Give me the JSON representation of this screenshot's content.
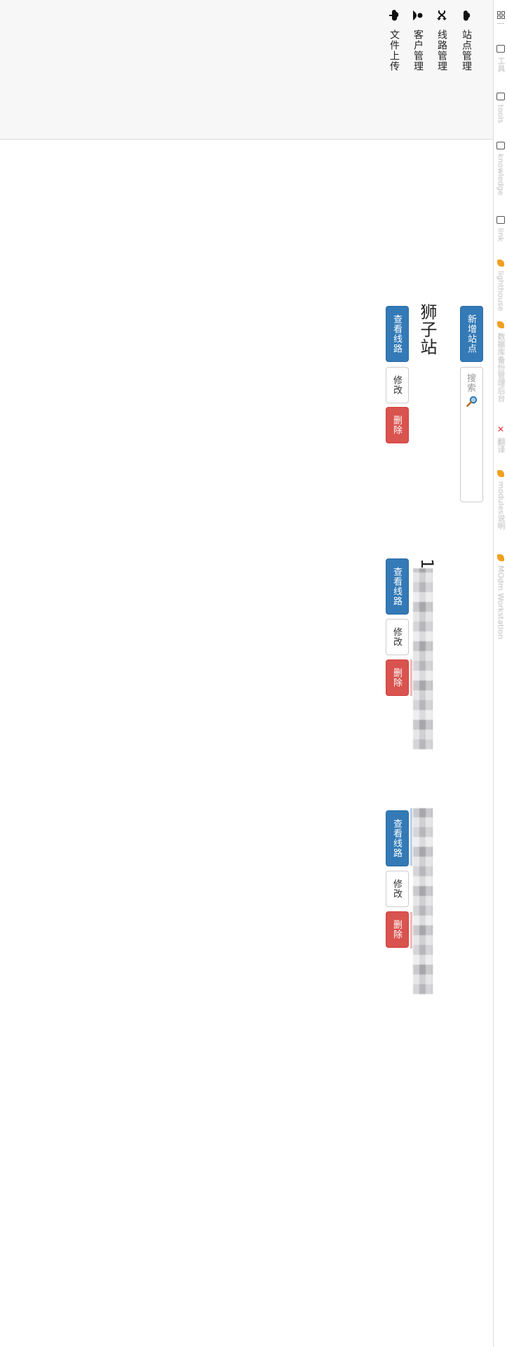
{
  "bookmarks": {
    "items": [
      {
        "icon": "folder-icon",
        "label": "工具"
      },
      {
        "icon": "folder-icon",
        "label": "tools"
      },
      {
        "icon": "folder-icon",
        "label": "knowledge"
      },
      {
        "icon": "folder-icon",
        "label": "link"
      },
      {
        "icon": "bookmark-icon",
        "label": "lighthouse"
      },
      {
        "icon": "bookmark-icon",
        "label": "数据库备份管理后台"
      },
      {
        "icon": "bookmark-icon",
        "label": "翻译"
      },
      {
        "icon": "bookmark-icon",
        "label": "modules说明"
      },
      {
        "icon": "bookmark-icon",
        "label": "MOdm Workstation"
      }
    ]
  },
  "sidebar": {
    "items": [
      {
        "icon": "cloud-icon",
        "label": "站点管理"
      },
      {
        "icon": "shuffle-icon",
        "label": "线路管理"
      },
      {
        "icon": "user-icon",
        "label": "客户管理"
      },
      {
        "icon": "upload-icon",
        "label": "文件上传"
      }
    ]
  },
  "toolbar": {
    "add_site_label": "新增站点",
    "search_placeholder": "搜索"
  },
  "sites": [
    {
      "name": "狮子站",
      "view_routes_label": "查看线路",
      "edit_label": "修改",
      "delete_label": "删除"
    },
    {
      "name": "1",
      "view_routes_label": "查看线路",
      "edit_label": "修改",
      "delete_label": "删除"
    },
    {
      "name": "",
      "view_routes_label": "查看线路",
      "edit_label": "修改",
      "delete_label": "删除"
    }
  ],
  "colors": {
    "primary": "#337ab7",
    "danger": "#d9534f",
    "sidebar_bg": "#f7f7f7"
  }
}
